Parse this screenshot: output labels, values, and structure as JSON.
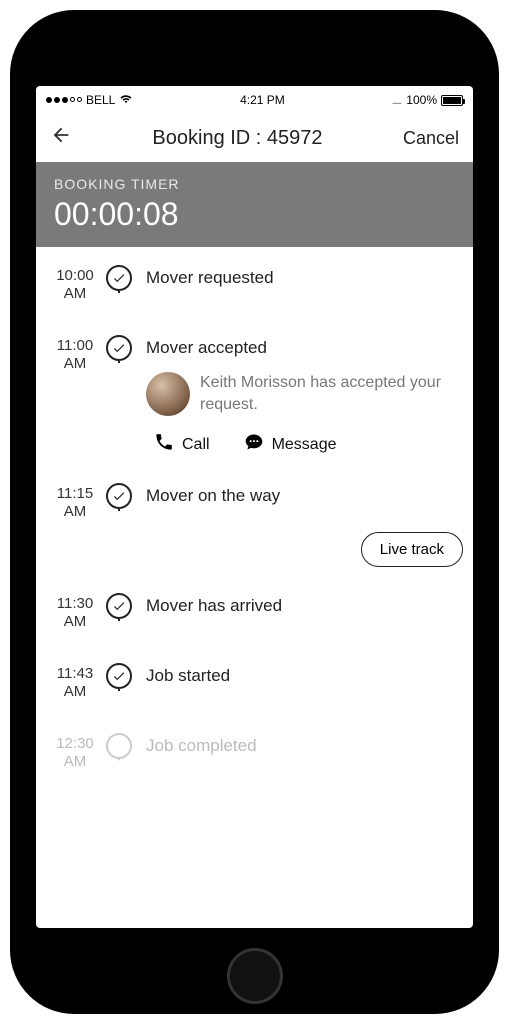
{
  "statusbar": {
    "carrier": "BELL",
    "time": "4:21 PM",
    "battery_pct": "100%"
  },
  "header": {
    "title": "Booking ID : 45972",
    "cancel_label": "Cancel"
  },
  "timer": {
    "label": "BOOKING TIMER",
    "value": "00:00:08"
  },
  "timeline": [
    {
      "time_top": "10:00",
      "time_bot": "AM",
      "title": "Mover requested",
      "done": true
    },
    {
      "time_top": "11:00",
      "time_bot": "AM",
      "title": "Mover accepted",
      "done": true,
      "detail_name": "Keith Morisson",
      "detail_suffix": " has accepted your request.",
      "call_label": "Call",
      "message_label": "Message"
    },
    {
      "time_top": "11:15",
      "time_bot": "AM",
      "title": "Mover on the way",
      "done": true,
      "live_track_label": "Live track"
    },
    {
      "time_top": "11:30",
      "time_bot": "AM",
      "title": "Mover has arrived",
      "done": true
    },
    {
      "time_top": "11:43",
      "time_bot": "AM",
      "title": "Job started",
      "done": true
    },
    {
      "time_top": "12:30",
      "time_bot": "AM",
      "title": "Job completed",
      "done": false
    }
  ]
}
